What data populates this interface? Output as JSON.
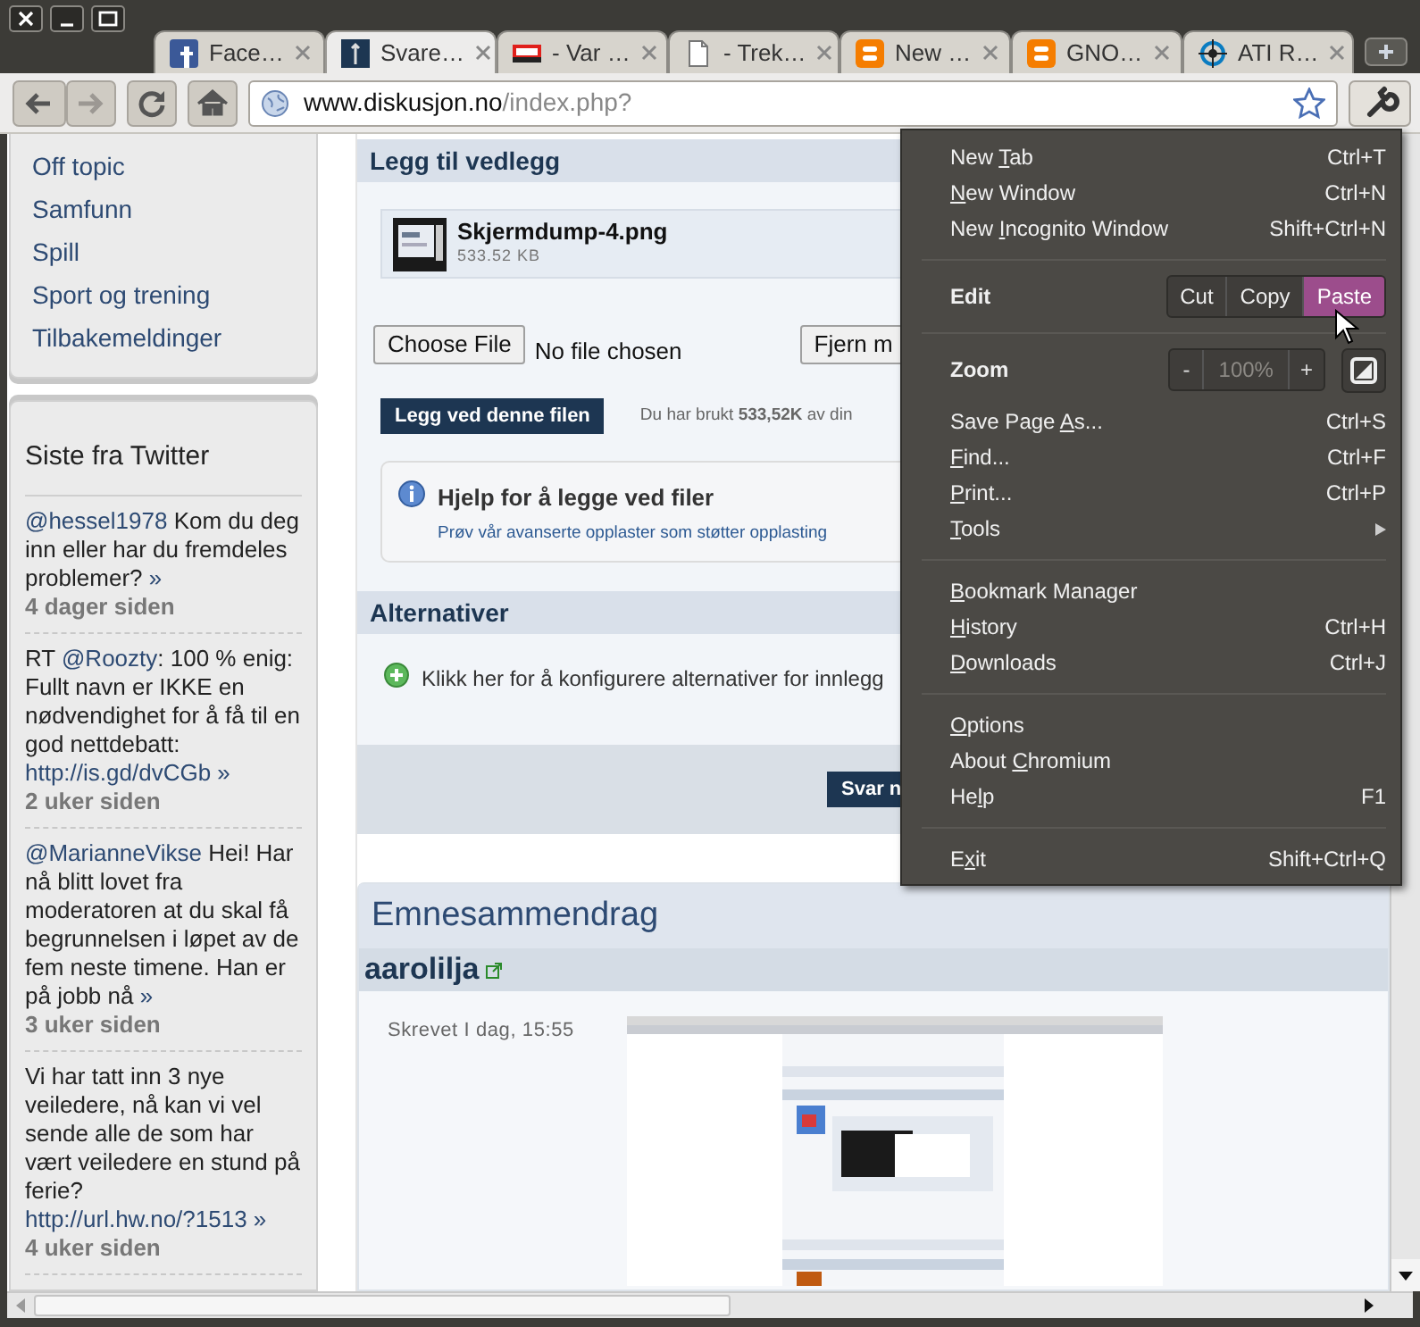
{
  "tabs": [
    {
      "title": "Face…",
      "selected": false
    },
    {
      "title": "Svare…",
      "selected": true
    },
    {
      "title": "- Var …",
      "selected": false
    },
    {
      "title": "- Trek…",
      "selected": false
    },
    {
      "title": "New …",
      "selected": false
    },
    {
      "title": "GNO…",
      "selected": false
    },
    {
      "title": "ATI R…",
      "selected": false
    }
  ],
  "toolbar": {
    "url_host": "www.diskusjon.no",
    "url_path": "/index.php?"
  },
  "sidebar": {
    "categories": [
      "Off topic",
      "Samfunn",
      "Spill",
      "Sport og trening",
      "Tilbakemeldinger"
    ],
    "twitter": {
      "title": "Siste fra Twitter",
      "tweets": [
        {
          "segments": [
            {
              "kind": "link",
              "text": "@hessel1978"
            },
            {
              "kind": "text",
              "text": " Kom du deg inn eller har du fremdeles problemer? "
            },
            {
              "kind": "more",
              "text": "»"
            }
          ],
          "time": "4 dager siden"
        },
        {
          "segments": [
            {
              "kind": "text",
              "text": "RT "
            },
            {
              "kind": "link",
              "text": "@Roozty"
            },
            {
              "kind": "text",
              "text": ": 100 % enig: Fullt navn er IKKE en nødvendighet for å få til en god nettdebatt: "
            },
            {
              "kind": "link",
              "text": "http://is.gd/dvCGb"
            },
            {
              "kind": "more",
              "text": " »"
            }
          ],
          "time": "2 uker siden"
        },
        {
          "segments": [
            {
              "kind": "link",
              "text": "@MarianneVikse"
            },
            {
              "kind": "text",
              "text": " Hei! Har nå blitt lovet fra moderatoren at du skal få begrunnelsen i løpet av de fem neste timene. Han er på jobb nå "
            },
            {
              "kind": "more",
              "text": "»"
            }
          ],
          "time": "3 uker siden"
        },
        {
          "segments": [
            {
              "kind": "text",
              "text": "Vi har tatt inn 3 nye veiledere, nå kan vi vel sende alle de som har vært veiledere en stund på ferie? "
            },
            {
              "kind": "link",
              "text": "http://url.hw.no/?1513"
            },
            {
              "kind": "more",
              "text": " »"
            }
          ],
          "time": "4 uker siden"
        }
      ]
    }
  },
  "attachments": {
    "title": "Legg til vedlegg",
    "file": {
      "name": "Skjermdump-4.png",
      "size": "533.52 KB"
    },
    "choose_button": "Choose File",
    "no_file": "No file chosen",
    "remove_button": "Fjern m",
    "attach_button": "Legg ved denne filen",
    "quota": "Du har brukt **533,52K** av din",
    "help": {
      "title": "Hjelp for å legge ved filer",
      "text": "Prøv vår avanserte opplaster som støtter opplasting"
    }
  },
  "options": {
    "title": "Alternativer",
    "text": "Klikk her for å konfigurere alternativer for innlegg",
    "submit_button": "Svar n"
  },
  "summary": {
    "title": "Emnesammendrag",
    "author": "aarolilja",
    "posted": "Skrevet I dag, 15:55"
  },
  "menu": {
    "items": [
      {
        "kind": "item",
        "label": {
          "before": "New ",
          "key": "T",
          "after": "ab"
        },
        "shortcut": "Ctrl+T"
      },
      {
        "kind": "item",
        "label": {
          "key": "N",
          "after": "ew Window"
        },
        "shortcut": "Ctrl+N"
      },
      {
        "kind": "item",
        "label": {
          "before": "New ",
          "key": "I",
          "after": "ncognito Window"
        },
        "shortcut": "Shift+Ctrl+N"
      },
      {
        "kind": "separator"
      },
      {
        "kind": "edit",
        "label": "Edit",
        "buttons": [
          {
            "label": "Cut",
            "selected": false
          },
          {
            "label": "Copy",
            "selected": false
          },
          {
            "label": "Paste",
            "selected": true
          }
        ]
      },
      {
        "kind": "separator"
      },
      {
        "kind": "zoom",
        "label": "Zoom",
        "minus": "-",
        "value": "100%",
        "plus": "+"
      },
      {
        "kind": "item",
        "label": {
          "before": "Save Page ",
          "key": "A",
          "after": "s..."
        },
        "shortcut": "Ctrl+S"
      },
      {
        "kind": "item",
        "label": {
          "key": "F",
          "after": "ind..."
        },
        "shortcut": "Ctrl+F"
      },
      {
        "kind": "item",
        "label": {
          "key": "P",
          "after": "rint..."
        },
        "shortcut": "Ctrl+P"
      },
      {
        "kind": "submenu",
        "label": {
          "key": "T",
          "after": "ools"
        }
      },
      {
        "kind": "separator"
      },
      {
        "kind": "item",
        "label": {
          "key": "B",
          "after": "ookmark Manager"
        }
      },
      {
        "kind": "item",
        "label": {
          "key": "H",
          "after": "istory"
        },
        "shortcut": "Ctrl+H"
      },
      {
        "kind": "item",
        "label": {
          "key": "D",
          "after": "ownloads"
        },
        "shortcut": "Ctrl+J"
      },
      {
        "kind": "separator"
      },
      {
        "kind": "item",
        "label": {
          "key": "O",
          "after": "ptions"
        }
      },
      {
        "kind": "item",
        "label": {
          "before": "About ",
          "key": "C",
          "after": "hromium"
        }
      },
      {
        "kind": "item",
        "label": {
          "before": "He",
          "key": "l",
          "after": "p"
        },
        "shortcut": "F1"
      },
      {
        "kind": "separator"
      },
      {
        "kind": "item",
        "label": {
          "before": "E",
          "key": "x",
          "after": "it"
        },
        "shortcut": "Shift+Ctrl+Q"
      }
    ]
  }
}
